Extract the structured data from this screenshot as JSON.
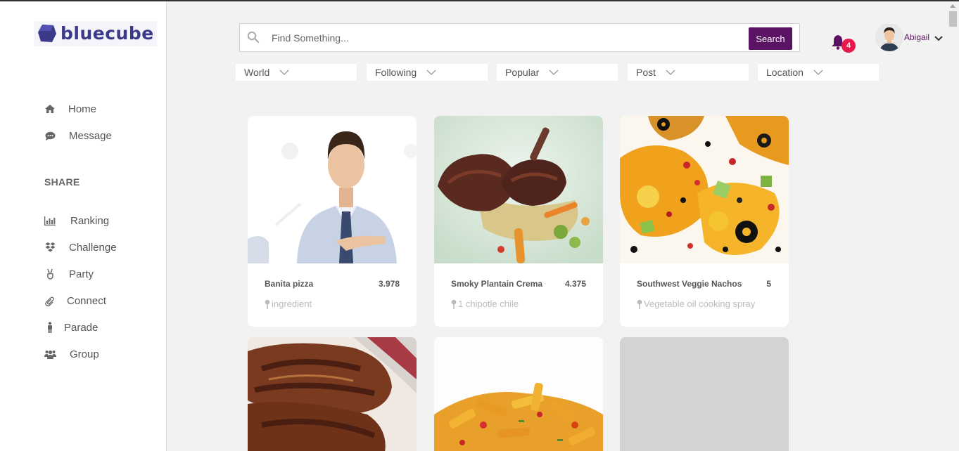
{
  "brand": {
    "name": "bluecube",
    "color": "#3b3a8a"
  },
  "sidebar": {
    "main_items": [
      {
        "label": "Home",
        "icon": "home-icon"
      },
      {
        "label": "Message",
        "icon": "chat-icon"
      }
    ],
    "section_title": "SHARE",
    "share_items": [
      {
        "label": "Ranking",
        "icon": "bar-chart-icon"
      },
      {
        "label": "Challenge",
        "icon": "dropbox-icon"
      },
      {
        "label": "Party",
        "icon": "peace-hand-icon"
      },
      {
        "label": "Connect",
        "icon": "paperclip-icon"
      },
      {
        "label": "Parade",
        "icon": "person-icon"
      },
      {
        "label": "Group",
        "icon": "users-icon"
      }
    ]
  },
  "search": {
    "placeholder": "Find Something...",
    "value": "",
    "button_label": "Search",
    "accent": "#5b1463"
  },
  "notifications": {
    "count": "4",
    "badge_color": "#e8194a"
  },
  "user": {
    "name": "Abigail"
  },
  "filters": [
    {
      "label": "World"
    },
    {
      "label": "Following"
    },
    {
      "label": "Popular"
    },
    {
      "label": "Post"
    },
    {
      "label": "Location"
    }
  ],
  "cards": [
    {
      "title": "Banita pizza",
      "score": "3.978",
      "ingredient": "ingredient",
      "image": "man-pointing-image"
    },
    {
      "title": "Smoky Plantain Crema",
      "score": "4.375",
      "ingredient": "1 chipotle chile",
      "image": "grilled-meat-dish-image"
    },
    {
      "title": "Southwest Veggie Nachos",
      "score": "5",
      "ingredient": "Vegetable oil cooking spray",
      "image": "nachos-image"
    },
    {
      "title": "",
      "score": "",
      "ingredient": "",
      "image": "grilled-pork-chops-image"
    },
    {
      "title": "",
      "score": "",
      "ingredient": "",
      "image": "penne-pasta-image"
    },
    {
      "title": "",
      "score": "",
      "ingredient": "",
      "image": "placeholder-image"
    }
  ]
}
